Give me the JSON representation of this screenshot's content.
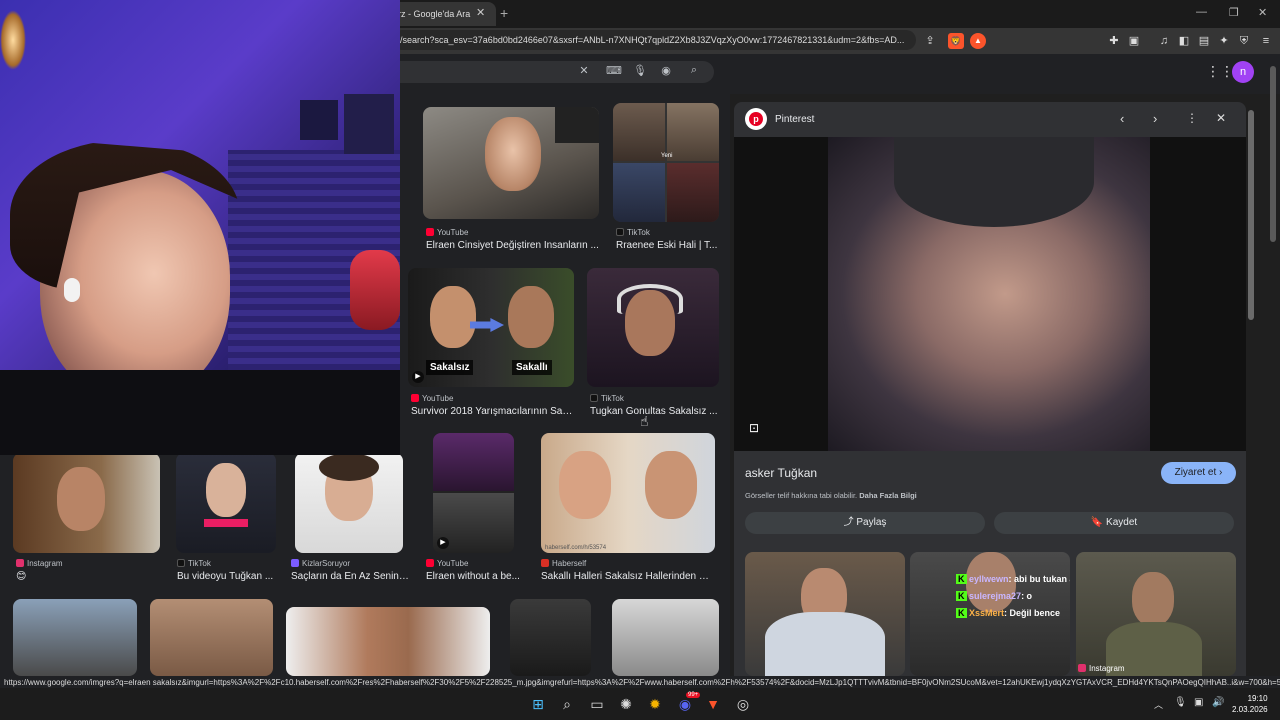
{
  "browser": {
    "tab_title": "rz - Google'da Ara",
    "tab_close": "✕",
    "new_tab": "+",
    "url": "/search?sca_esv=37a6bd0bd2466e07&sxsrf=ANbL-n7XNHQt7qpldZ2Xb8J3ZVqzXyO0vw:1772467821331&udm=2&fbs=AD...",
    "brave_badge": "▲",
    "status_url": "https://www.google.com/imgres?q=elraen sakalsız&imgurl=https%3A%2F%2Fc10.haberself.com%2Fres%2Fhaberself%2F30%2F5%2F228525_m.jpg&imgrefurl=https%3A%2F%2Fwww.haberself.com%2Fh%2F53574%2F&docid=MzLJp1QTTTvivM&tbnid=BF0jvONm2SUcoM&vet=12ahUKEwj1ydqXzYGTAxVCR_EDHd4YKTsQnPAOegQIHhAB..i&w=700&h=5..."
  },
  "google": {
    "avatar_letter": "n"
  },
  "results": [
    {
      "source": "YouTube",
      "title": "Elraen Cinsiyet Değiştiren İnsanların ...",
      "fav": "#ff0033"
    },
    {
      "source": "TikTok",
      "title": "Rraenee Eski Hali | T...",
      "fav": "#111111"
    },
    {
      "source": "YouTube",
      "title": "Survivor 2018 Yarışmacılarının Sak...",
      "fav": "#ff0033",
      "label_left": "Sakalsız",
      "label_right": "Sakallı"
    },
    {
      "source": "TikTok",
      "title": "Tugkan Gonultas Sakalsız ...",
      "fav": "#111111"
    },
    {
      "source": "Instagram",
      "title": "😊",
      "fav": "#e1306c"
    },
    {
      "source": "TikTok",
      "title": "Bu videoyu Tuğkan ...",
      "fav": "#111111"
    },
    {
      "source": "KizlarSoruyor",
      "title": "Saçların da En Az Senin ...",
      "fav": "#7b5cff"
    },
    {
      "source": "YouTube",
      "title": "Elraen without a be...",
      "fav": "#ff0033"
    },
    {
      "source": "Haberself",
      "title": "Sakallı Halleri Sakalsız Hallerinden Ço...",
      "fav": "#d93025"
    }
  ],
  "thumb_badges": {
    "yeni": "Yeni",
    "watermark": "haberself.com/h/53574"
  },
  "panel": {
    "source": "Pinterest",
    "title": "asker Tuğkan",
    "visit": "Ziyaret et",
    "copyright_note": "Görseller telif hakkına tabi olabilir.",
    "more_info": "Daha Fazla Bilgi",
    "share": "Paylaş",
    "save": "Kaydet",
    "related_source": "Instagram",
    "chat": [
      {
        "user": "eyllwewn",
        "msg": ": abi bu tukan abi",
        "color": "#c9b6ff"
      },
      {
        "user": "sulerejma27",
        "msg": ": o",
        "color": "#c9b6ff"
      },
      {
        "user": "XssMert",
        "msg": ": Değil bence",
        "color": "#ffb347"
      }
    ]
  },
  "taskbar": {
    "time": "19:10",
    "date": "2.03.2026",
    "discord_badge": "99+"
  },
  "colors": {
    "accent": "#8ab4f8",
    "panel_bg": "#303134",
    "page_bg": "#202124"
  }
}
